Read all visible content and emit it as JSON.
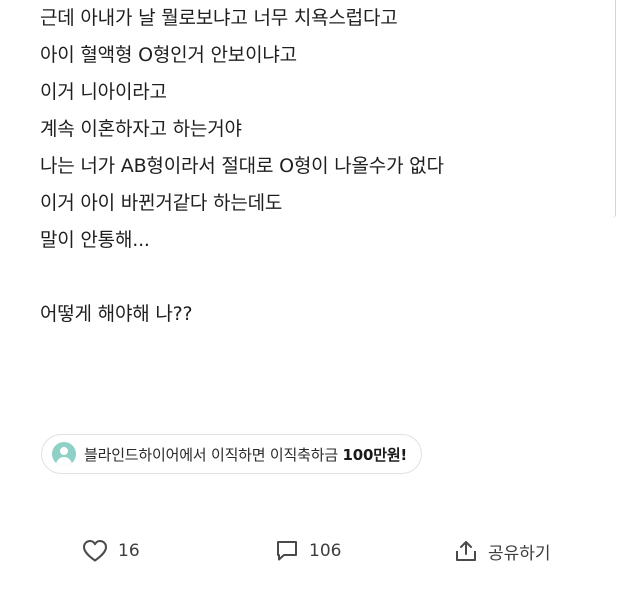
{
  "post": {
    "lines": [
      "근데 아내가 날 뭘로보냐고 너무 치욕스럽다고",
      "아이 혈액형 O형인거 안보이냐고",
      "이거 니아이라고",
      "계속 이혼하자고 하는거야",
      "나는 너가 AB형이라서 절대로 O형이 나올수가 없다",
      "이거 아이 바뀐거같다 하는데도",
      "말이 안통해...",
      "",
      "어떻게 해야해 나??"
    ]
  },
  "promo": {
    "text_prefix": "블라인드하이어에서 이직하면 이직축하금 ",
    "text_bold": "100만원!",
    "icon": "user-avatar-icon",
    "avatar_color": "#8fd1c7"
  },
  "actions": {
    "like_count": "16",
    "comment_count": "106",
    "share_label": "공유하기",
    "icons": {
      "like": "heart-outline-icon",
      "comment": "comment-bubble-icon",
      "share": "share-upload-icon"
    }
  }
}
